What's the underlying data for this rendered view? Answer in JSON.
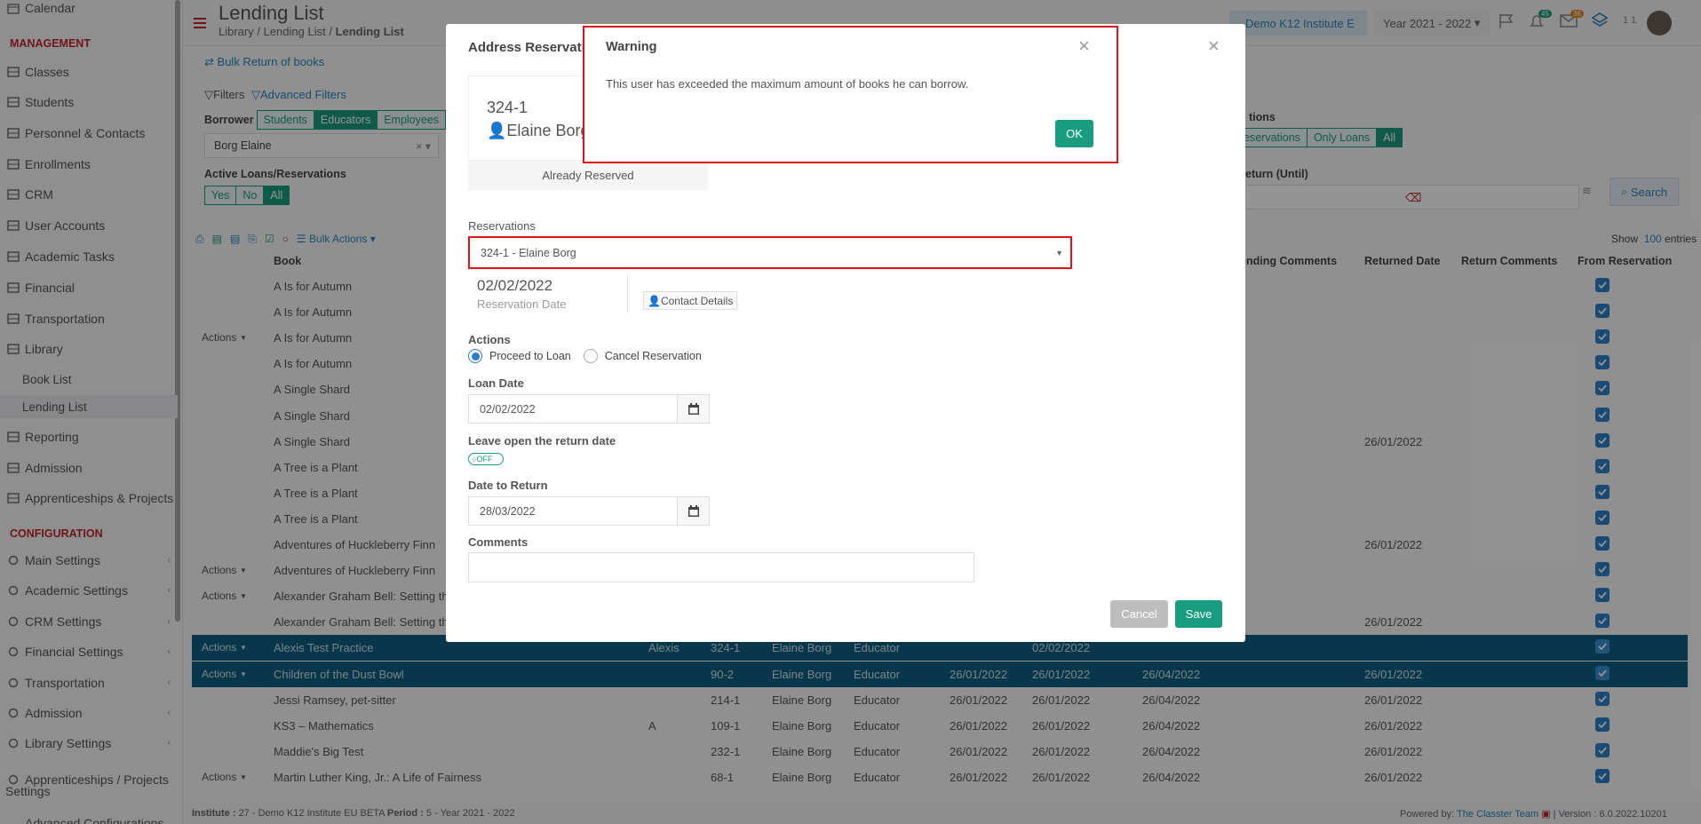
{
  "sidebar": {
    "top_item": "Calendar",
    "section_management": "MANAGEMENT",
    "items": [
      {
        "label": "Classes",
        "icon": "classes-icon"
      },
      {
        "label": "Students",
        "icon": "students-icon"
      },
      {
        "label": "Personnel & Contacts",
        "icon": "personnel-icon"
      },
      {
        "label": "Enrollments",
        "icon": "enrollments-icon"
      },
      {
        "label": "CRM",
        "icon": "crm-icon"
      },
      {
        "label": "User Accounts",
        "icon": "user-accounts-icon"
      },
      {
        "label": "Academic Tasks",
        "icon": "academic-tasks-icon"
      },
      {
        "label": "Financial",
        "icon": "financial-icon"
      },
      {
        "label": "Transportation",
        "icon": "transportation-icon"
      },
      {
        "label": "Library",
        "icon": "library-icon"
      },
      {
        "label": "Book List",
        "icon": ""
      },
      {
        "label": "Lending List",
        "icon": ""
      },
      {
        "label": "Reporting",
        "icon": "reporting-icon"
      },
      {
        "label": "Admission",
        "icon": "admission-icon"
      },
      {
        "label": "Apprenticeships & Projects",
        "icon": "apprenticeships-icon"
      }
    ],
    "section_configuration": "CONFIGURATION",
    "config_items": [
      {
        "label": "Main Settings",
        "icon": "main-settings-icon"
      },
      {
        "label": "Academic Settings",
        "icon": "academic-settings-icon"
      },
      {
        "label": "CRM Settings",
        "icon": "crm-settings-icon"
      },
      {
        "label": "Financial Settings",
        "icon": "financial-settings-icon"
      },
      {
        "label": "Transportation",
        "icon": "transportation-icon"
      },
      {
        "label": "Admission",
        "icon": "admission-icon"
      },
      {
        "label": "Library Settings",
        "icon": "library-settings-icon"
      },
      {
        "label": "Apprenticeships / Projects",
        "icon": "apprenticeships-icon"
      },
      {
        "label": "Settings",
        "icon": ""
      },
      {
        "label": "Advanced Configurations",
        "icon": ""
      }
    ]
  },
  "header": {
    "title": "Lending List",
    "breadcrumb": [
      "Library",
      "Lending List",
      "Lending List"
    ],
    "institute": "Demo K12 Institute E",
    "year": "Year 2021 - 2022",
    "notif_count": "45",
    "msg_count": "36",
    "user_short": "1 1"
  },
  "toolbar": {
    "bulk_return": "Bulk Return of books",
    "filters": "Filters",
    "advanced_filters": "Advanced Filters",
    "borrower_label": "Borrower",
    "borrower_options": [
      "Students",
      "Educators",
      "Employees"
    ],
    "borrower_value": "Borg Elaine",
    "active_label": "Active Loans/Reservations",
    "active_options": [
      "Yes",
      "No",
      "All"
    ],
    "show_label": "Show",
    "show_value": "100",
    "entries": "entries",
    "reservations_label": "tions",
    "reservation_options": [
      "eservations",
      "Only Loans",
      "All"
    ],
    "return_until_label": "eturn (Until)",
    "search_label": "Search",
    "bulk_actions": "Bulk Actions"
  },
  "table": {
    "headers": {
      "book": "Book",
      "lending_comments": "ending Comments",
      "returned_date": "Returned Date",
      "return_comments": "Return Comments",
      "from_reservation": "From Reservation"
    },
    "rows": [
      {
        "actions": "",
        "book": "A Is for Autumn",
        "col1": "",
        "code": "",
        "borrower": "",
        "type": "",
        "d1": "",
        "d2": "",
        "d3": "",
        "returned": ""
      },
      {
        "actions": "",
        "book": "A Is for Autumn",
        "col1": "",
        "code": "",
        "borrower": "",
        "type": "",
        "d1": "",
        "d2": "",
        "d3": "",
        "returned": ""
      },
      {
        "actions": "Actions",
        "book": "A Is for Autumn",
        "col1": "",
        "code": "",
        "borrower": "",
        "type": "",
        "d1": "",
        "d2": "",
        "d3": "",
        "returned": ""
      },
      {
        "actions": "",
        "book": "A Is for Autumn",
        "col1": "",
        "code": "",
        "borrower": "",
        "type": "",
        "d1": "",
        "d2": "",
        "d3": "",
        "returned": ""
      },
      {
        "actions": "",
        "book": "A Single Shard",
        "col1": "",
        "code": "",
        "borrower": "",
        "type": "",
        "d1": "",
        "d2": "",
        "d3": "",
        "returned": ""
      },
      {
        "actions": "",
        "book": "A Single Shard",
        "col1": "",
        "code": "",
        "borrower": "",
        "type": "",
        "d1": "",
        "d2": "",
        "d3": "",
        "returned": ""
      },
      {
        "actions": "",
        "book": "A Single Shard",
        "col1": "",
        "code": "",
        "borrower": "",
        "type": "",
        "d1": "",
        "d2": "",
        "d3": "",
        "returned": "26/01/2022"
      },
      {
        "actions": "",
        "book": "A Tree is a Plant",
        "col1": "",
        "code": "",
        "borrower": "",
        "type": "",
        "d1": "",
        "d2": "",
        "d3": "",
        "returned": ""
      },
      {
        "actions": "",
        "book": "A Tree is a Plant",
        "col1": "",
        "code": "",
        "borrower": "",
        "type": "",
        "d1": "",
        "d2": "",
        "d3": "",
        "returned": ""
      },
      {
        "actions": "",
        "book": "A Tree is a Plant",
        "col1": "",
        "code": "",
        "borrower": "",
        "type": "",
        "d1": "",
        "d2": "",
        "d3": "",
        "returned": ""
      },
      {
        "actions": "",
        "book": "Adventures of Huckleberry Finn",
        "col1": "",
        "code": "",
        "borrower": "",
        "type": "",
        "d1": "",
        "d2": "",
        "d3": "",
        "returned": "26/01/2022"
      },
      {
        "actions": "Actions",
        "book": "Adventures of Huckleberry Finn",
        "col1": "",
        "code": "",
        "borrower": "",
        "type": "",
        "d1": "",
        "d2": "",
        "d3": "",
        "returned": ""
      },
      {
        "actions": "Actions",
        "book": "Alexander Graham Bell: Setting th",
        "col1": "",
        "code": "",
        "borrower": "",
        "type": "",
        "d1": "",
        "d2": "",
        "d3": "",
        "returned": ""
      },
      {
        "actions": "",
        "book": "Alexander Graham Bell: Setting th",
        "col1": "",
        "code": "",
        "borrower": "",
        "type": "",
        "d1": "",
        "d2": "",
        "d3": "",
        "returned": "26/01/2022"
      },
      {
        "actions": "Actions",
        "book": "Alexis Test Practice",
        "col1": "Alexis",
        "code": "324-1",
        "borrower": "Elaine Borg",
        "type": "Educator",
        "d1": "",
        "d2": "02/02/2022",
        "d3": "",
        "returned": "",
        "sel": true
      },
      {
        "actions": "Actions",
        "book": "Children of the Dust Bowl",
        "col1": "",
        "code": "90-2",
        "borrower": "Elaine Borg",
        "type": "Educator",
        "d1": "26/01/2022",
        "d2": "26/01/2022",
        "d3": "26/04/2022",
        "returned": "26/01/2022",
        "sel": true
      },
      {
        "actions": "",
        "book": "Jessi Ramsey, pet-sitter",
        "col1": "",
        "code": "214-1",
        "borrower": "Elaine Borg",
        "type": "Educator",
        "d1": "26/01/2022",
        "d2": "26/01/2022",
        "d3": "26/04/2022",
        "returned": "26/01/2022"
      },
      {
        "actions": "",
        "book": "KS3 – Mathematics",
        "col1": "A",
        "code": "109-1",
        "borrower": "Elaine Borg",
        "type": "Educator",
        "d1": "26/01/2022",
        "d2": "26/01/2022",
        "d3": "26/04/2022",
        "returned": "26/01/2022"
      },
      {
        "actions": "",
        "book": "Maddie's Big Test",
        "col1": "",
        "code": "232-1",
        "borrower": "Elaine Borg",
        "type": "Educator",
        "d1": "26/01/2022",
        "d2": "26/01/2022",
        "d3": "26/04/2022",
        "returned": "26/01/2022"
      },
      {
        "actions": "Actions",
        "book": "Martin Luther King, Jr.: A Life of Fairness",
        "col1": "",
        "code": "68-1",
        "borrower": "Elaine Borg",
        "type": "Educator",
        "d1": "26/01/2022",
        "d2": "26/01/2022",
        "d3": "26/04/2022",
        "returned": "26/01/2022"
      }
    ]
  },
  "footer": {
    "institute_label": "Institute :",
    "institute_value": "27 - Demo K12 Institute EU BETA",
    "period_label": "Period :",
    "period_value": "5 - Year 2021 - 2022",
    "powered": "Powered by:",
    "team": "The Classter Team",
    "version": "| Version : 6.0.2022.10201"
  },
  "modal": {
    "title": "Address Reservatio",
    "card_code": "324-1",
    "card_name": "Elaine Borg",
    "card_status": "Already Reserved",
    "reservations_label": "Reservations",
    "reservations_value": "324-1 - Elaine Borg",
    "reservation_date": "02/02/2022",
    "reservation_date_label": "Reservation Date",
    "contact_details": "Contact Details",
    "actions_label": "Actions",
    "action_proceed": "Proceed to Loan",
    "action_cancel": "Cancel Reservation",
    "loan_date_label": "Loan Date",
    "loan_date": "02/02/2022",
    "leave_open_label": "Leave open the return date",
    "toggle_state": "OFF",
    "date_to_return_label": "Date to Return",
    "date_to_return": "28/03/2022",
    "comments_label": "Comments",
    "comments_value": "",
    "cancel": "Cancel",
    "save": "Save"
  },
  "warning": {
    "title": "Warning",
    "message": "This user has exceeded the maximum amount of books he can borrow.",
    "ok": "OK"
  },
  "colors": {
    "accent": "#1a9c7f",
    "danger": "#e0131b",
    "selected_row": "#0f5f82",
    "section": "#c0262d",
    "checkbox": "#2e7fc9"
  }
}
